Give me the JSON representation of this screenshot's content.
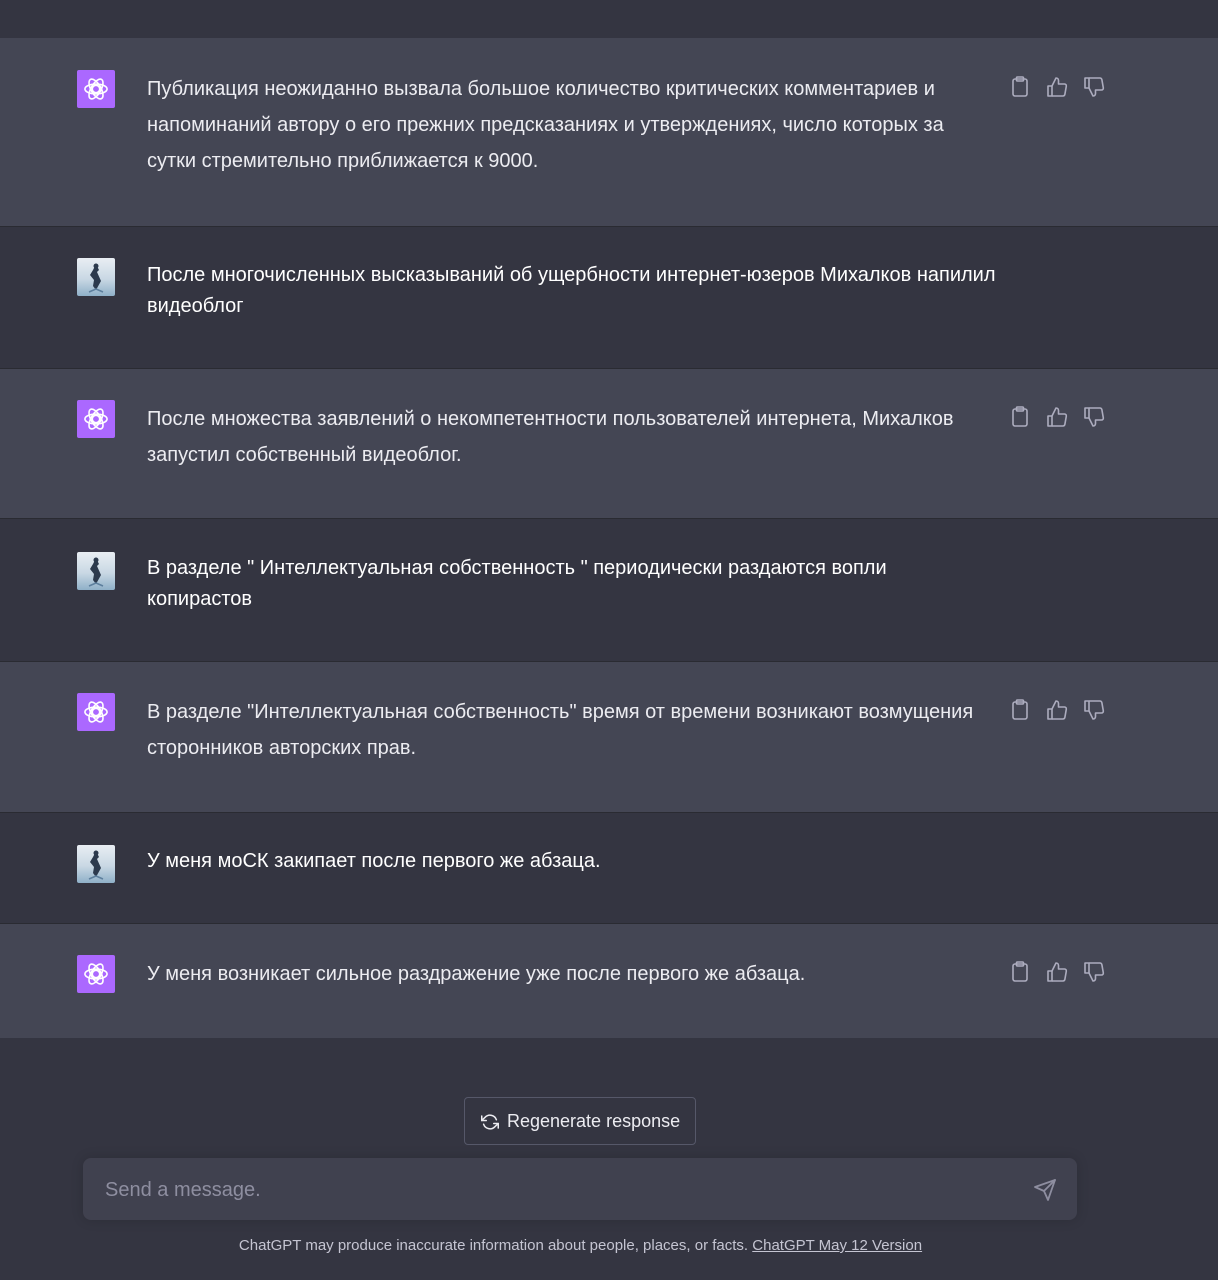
{
  "conversation": [
    {
      "role": "assistant",
      "text": "Публикация неожиданно вызвала большое количество критических комментариев и напоминаний автору о его прежних предсказаниях и утверждениях, число которых за сутки стремительно приближается к 9000."
    },
    {
      "role": "user",
      "text": "После многочисленных высказываний об ущербности интернет-юзеров Михалков напилил видеоблог"
    },
    {
      "role": "assistant",
      "text": "После множества заявлений о некомпетентности пользователей интернета, Михалков запустил собственный видеоблог."
    },
    {
      "role": "user",
      "text": "В разделе \" Интеллектуальная собственность \" периодически раздаются вопли копирастов"
    },
    {
      "role": "assistant",
      "text": "В разделе \"Интеллектуальная собственность\" время от времени возникают возмущения сторонников авторских прав."
    },
    {
      "role": "user",
      "text": "У меня моСК закипает после первого же абзаца."
    },
    {
      "role": "assistant",
      "text": "У меня возникает сильное раздражение уже после первого же абзаца."
    }
  ],
  "actions": {
    "copy_icon": "clipboard-icon",
    "like_icon": "thumbs-up-icon",
    "dislike_icon": "thumbs-down-icon"
  },
  "regenerate": {
    "label": "Regenerate response",
    "icon": "refresh-icon"
  },
  "composer": {
    "placeholder": "Send a message.",
    "send_icon": "paper-plane-icon"
  },
  "footer": {
    "text": "ChatGPT may produce inaccurate information about people, places, or facts.",
    "link": "ChatGPT May 12 Version"
  },
  "colors": {
    "background": "#343541",
    "assistant_row": "#444654",
    "gpt_avatar": "#ab68ff",
    "text": "#ececf1",
    "muted": "#c5c5d2"
  }
}
